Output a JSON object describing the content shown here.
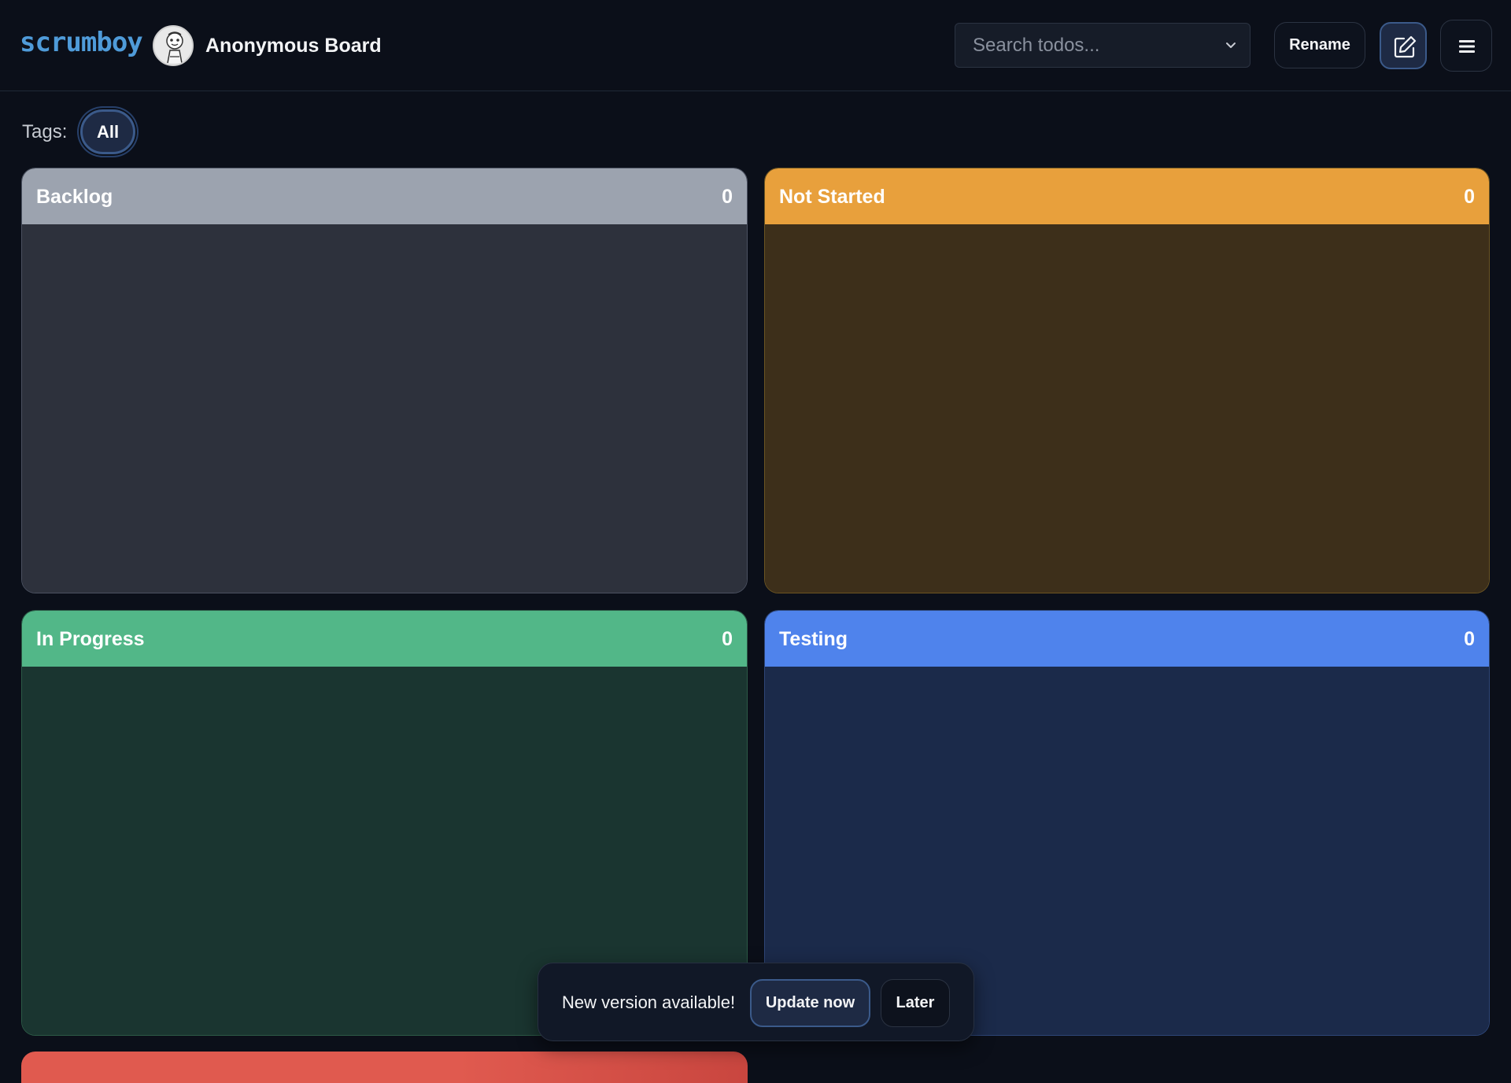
{
  "header": {
    "logo_text": "scrumboy",
    "board_title": "Anonymous Board",
    "search_placeholder": "Search todos...",
    "rename_label": "Rename",
    "edit_icon": "pencil-square-icon",
    "menu_icon": "hamburger-menu-icon"
  },
  "tags": {
    "label": "Tags:",
    "items": [
      {
        "label": "All",
        "selected": true
      }
    ]
  },
  "columns": [
    {
      "title": "Backlog",
      "count": "0",
      "color": "#9ca3af"
    },
    {
      "title": "Not Started",
      "count": "0",
      "color": "#e8a03c"
    },
    {
      "title": "In Progress",
      "count": "0",
      "color": "#52b788"
    },
    {
      "title": "Testing",
      "count": "0",
      "color": "#4f83ec"
    },
    {
      "color": "#e05a4f"
    }
  ],
  "toast": {
    "message": "New version available!",
    "update_label": "Update now",
    "later_label": "Later"
  }
}
